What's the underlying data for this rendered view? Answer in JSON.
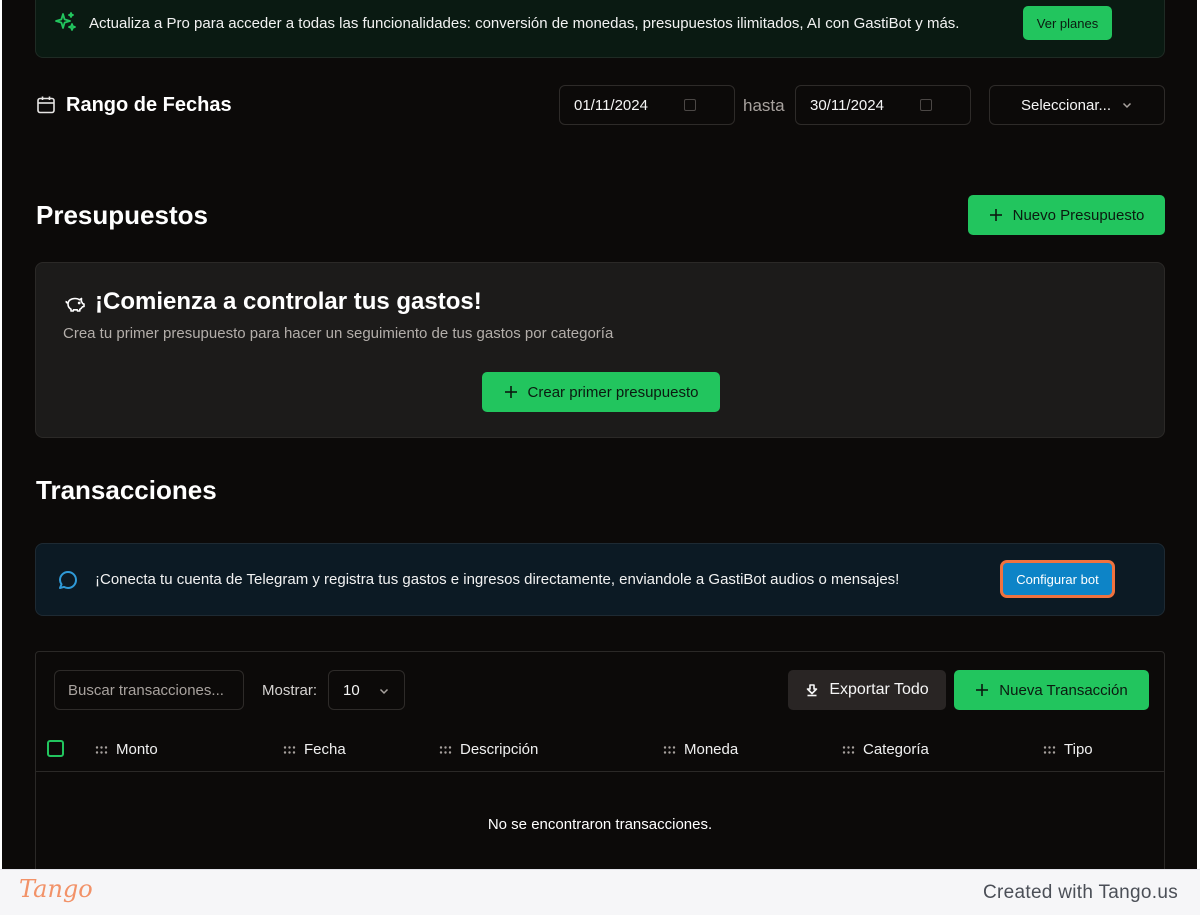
{
  "upgrade_banner": {
    "text": "Actualiza a Pro para acceder a todas las funcionalidades: conversión de monedas, presupuestos ilimitados, AI con GastiBot y más.",
    "button_label": "Ver planes"
  },
  "date_range": {
    "title": "Rango de Fechas",
    "from": "01/11/2024",
    "separator": "hasta",
    "to": "30/11/2024",
    "select_label": "Seleccionar..."
  },
  "budgets": {
    "title": "Presupuestos",
    "new_button_label": "Nuevo Presupuesto",
    "empty_card": {
      "headline": "¡Comienza a controlar tus gastos!",
      "subtitle": "Crea tu primer presupuesto para hacer un seguimiento de tus gastos por categoría",
      "button_label": "Crear primer presupuesto"
    }
  },
  "transactions": {
    "title": "Transacciones",
    "telegram_banner": {
      "text": "¡Conecta tu cuenta de Telegram y registra tus gastos e ingresos directamente, enviandole a GastiBot audios o mensajes!",
      "button_label": "Configurar bot"
    },
    "search_placeholder": "Buscar transacciones...",
    "show_label": "Mostrar:",
    "page_size": "10",
    "export_label": "Exportar Todo",
    "new_label": "Nueva Transacción",
    "columns": [
      "Monto",
      "Fecha",
      "Descripción",
      "Moneda",
      "Categoría",
      "Tipo"
    ],
    "empty_text": "No se encontraron transacciones."
  },
  "footer": {
    "logo": "Tango",
    "created_with": "Created with Tango.us"
  },
  "colors": {
    "accent_green": "#22c55e",
    "telegram_button": "#0d84c7",
    "highlight_outline": "#f0723e",
    "background": "#0c0a09"
  }
}
